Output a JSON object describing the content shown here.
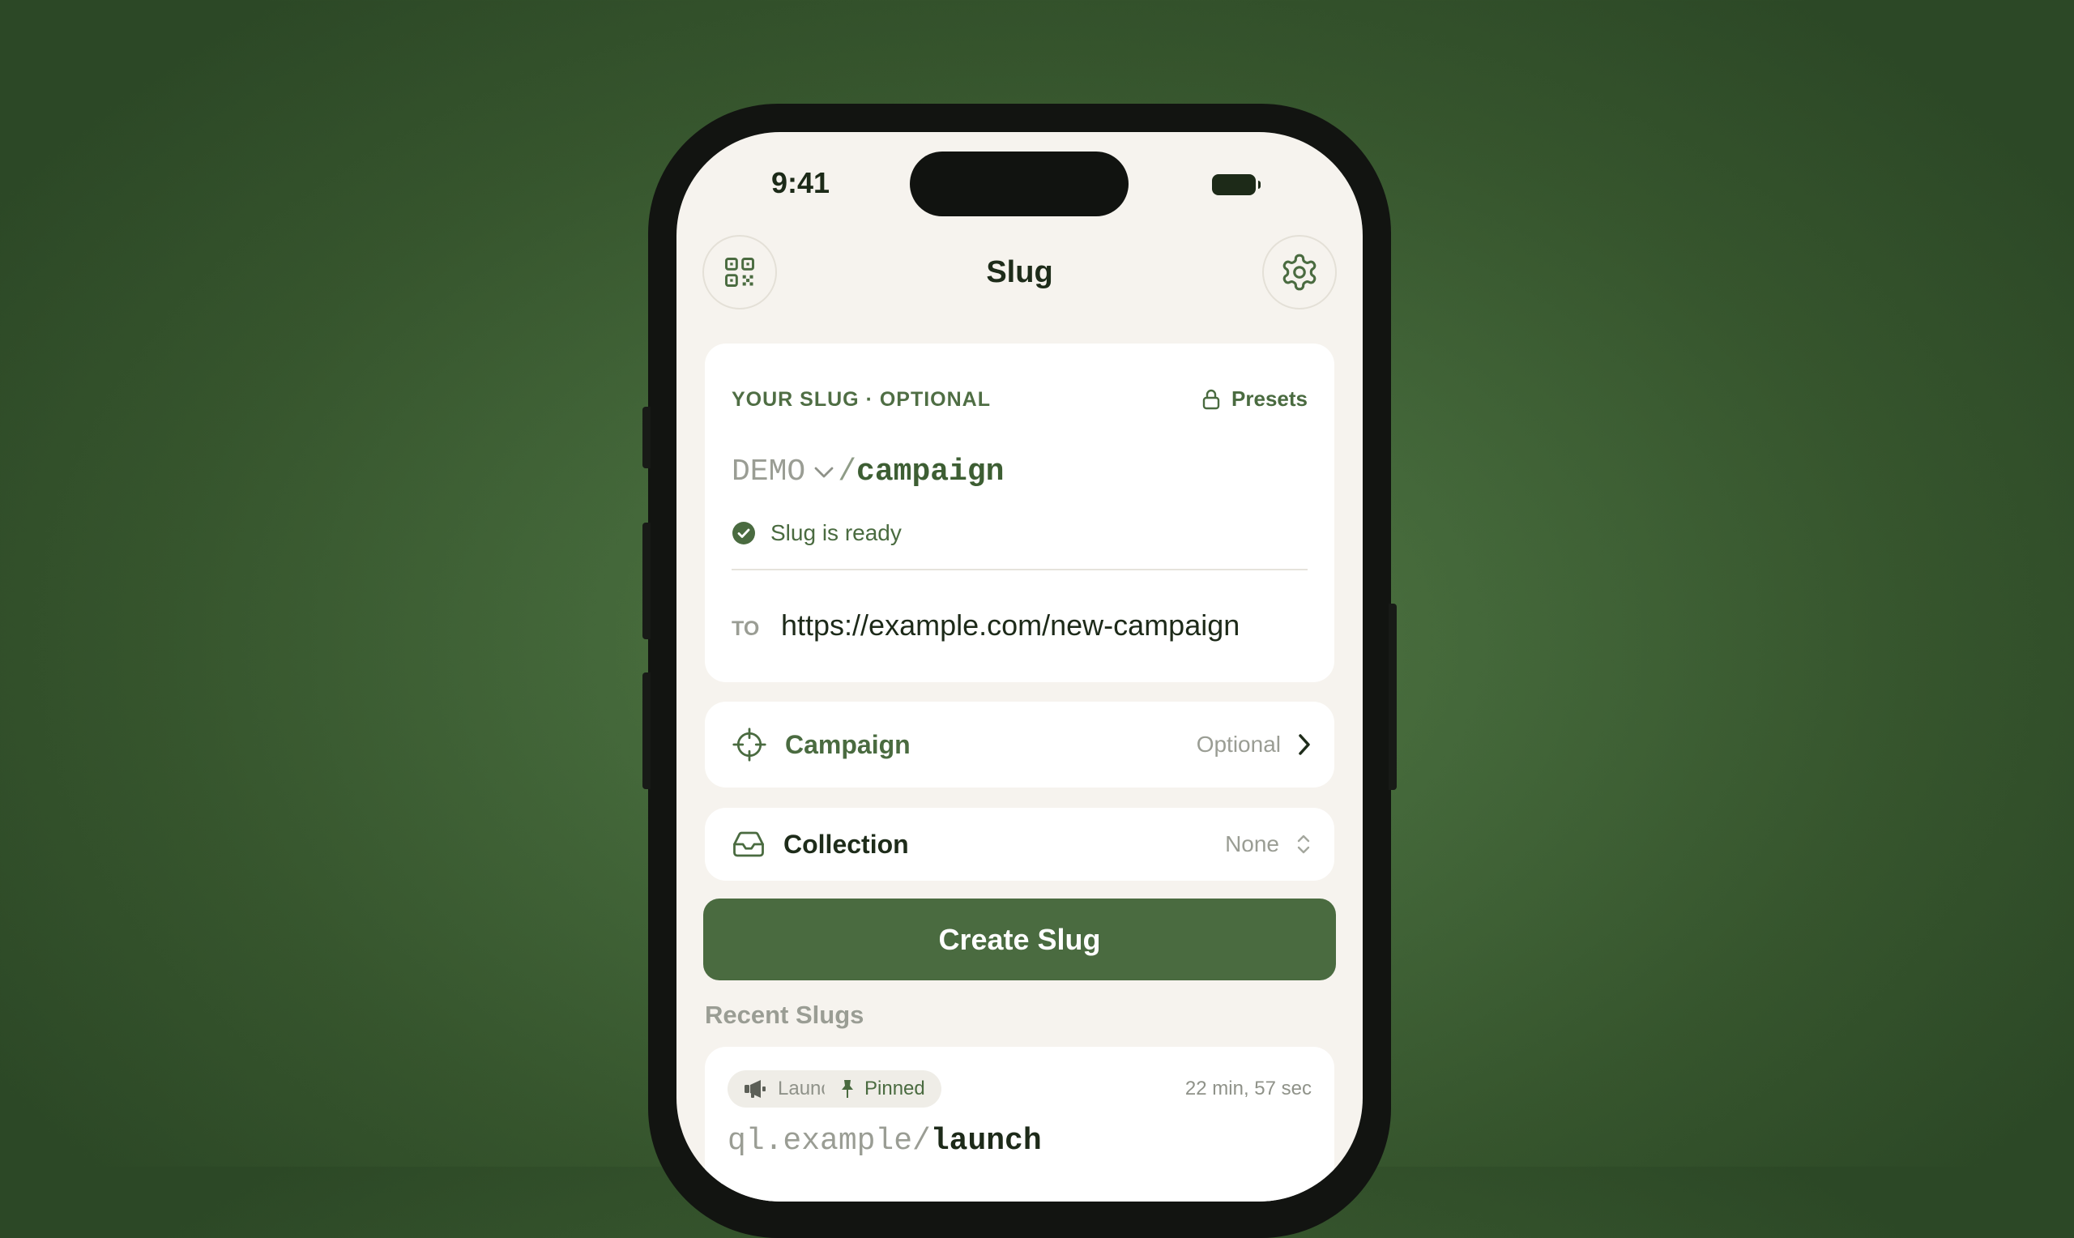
{
  "status_bar": {
    "time": "9:41"
  },
  "header": {
    "title": "Slug",
    "qr_icon": "qr-code-icon",
    "settings_icon": "gear-icon"
  },
  "slug_card": {
    "label": "YOUR SLUG · OPTIONAL",
    "presets_label": "Presets",
    "domain": "DEMO",
    "separator": "/",
    "path": "campaign",
    "status": "Slug is ready",
    "to_label": "TO",
    "destination_url": "https://example.com/new-campaign"
  },
  "campaign_row": {
    "label": "Campaign",
    "value": "Optional"
  },
  "collection_row": {
    "label": "Collection",
    "value": "None"
  },
  "create_button": {
    "label": "Create Slug"
  },
  "recent": {
    "title": "Recent Slugs",
    "items": [
      {
        "tags": [
          "Launch",
          "Pinned"
        ],
        "age": "22 min, 57 sec",
        "domain": "ql.example/",
        "path": "launch"
      }
    ]
  },
  "colors": {
    "accent": "#4a6b40",
    "background": "#3f6234",
    "surface": "#f6f3ee",
    "card": "#ffffff"
  }
}
